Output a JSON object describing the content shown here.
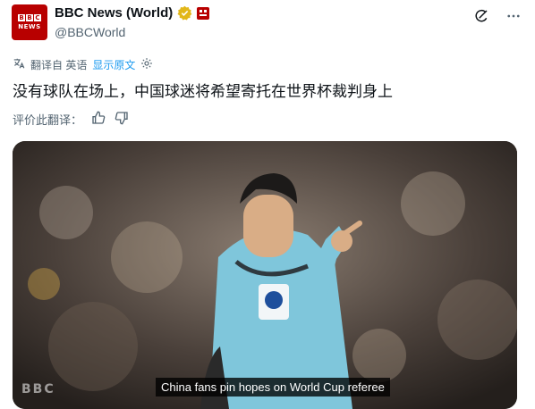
{
  "account": {
    "name": "BBC News (World)",
    "handle": "@BBCWorld",
    "avatar_text": [
      "B",
      "B",
      "C"
    ],
    "avatar_subtext": "NEWS",
    "brand_color": "#b80000"
  },
  "translation": {
    "translated_from": "翻译自 英语",
    "show_original": "显示原文"
  },
  "tweet": {
    "text": "没有球队在场上，中国球迷将希望寄托在世界杯裁判身上"
  },
  "rating": {
    "label": "评价此翻译："
  },
  "media": {
    "caption": "China fans pin hopes on World Cup referee",
    "logo_text": "BBC"
  },
  "icons": {
    "verified": "verified-badge-icon",
    "org": "org-badge-icon",
    "grok": "grok-icon",
    "more": "more-icon",
    "translate": "translate-icon",
    "settings": "gear-icon",
    "thumbs_up": "thumbs-up-icon",
    "thumbs_down": "thumbs-down-icon"
  },
  "colors": {
    "accent": "#1d9bf0",
    "secondary_text": "#536471",
    "verified_gold": "#e2b719"
  }
}
